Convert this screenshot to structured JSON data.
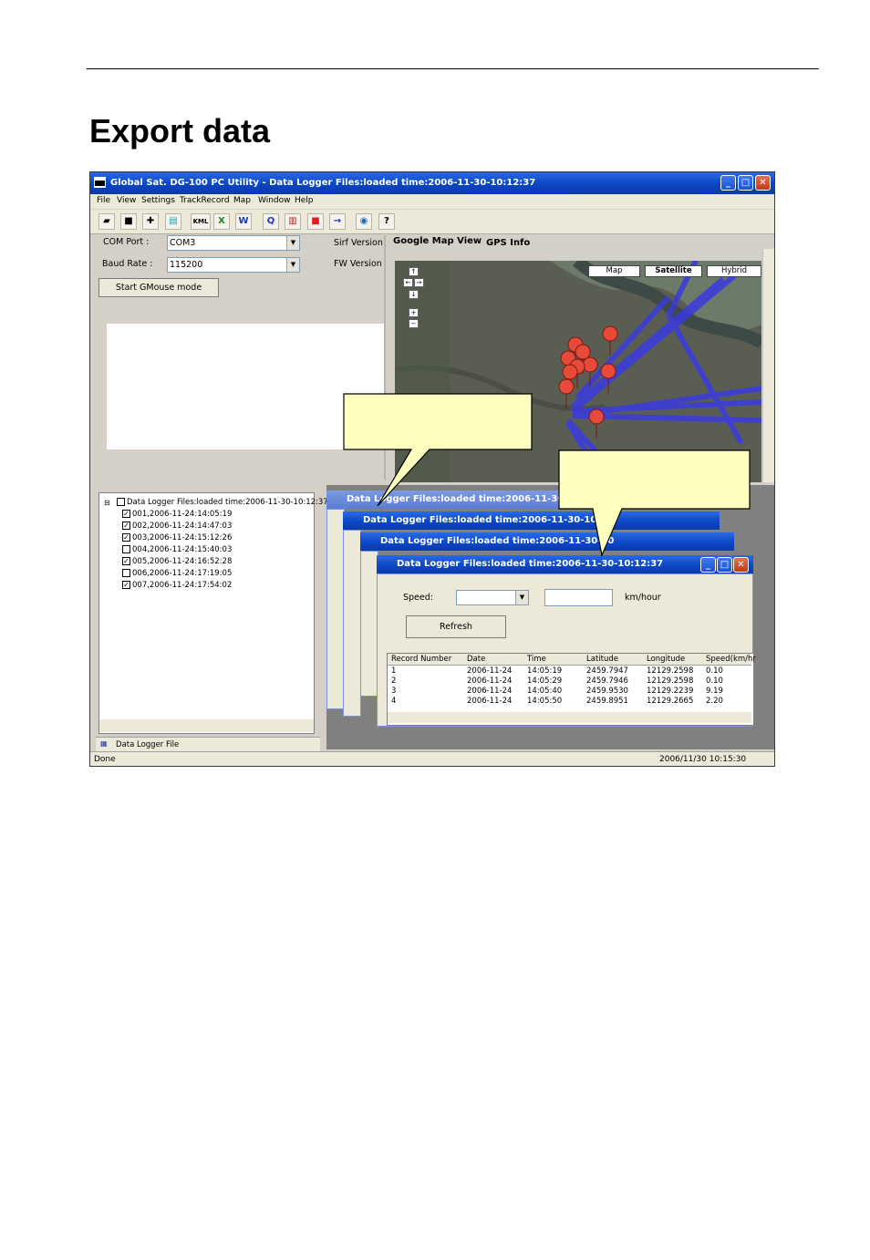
{
  "page": {
    "heading": "Export data"
  },
  "app": {
    "title": "Global Sat. DG-100 PC Utility - Data Logger Files:loaded time:2006-11-30-10:12:37",
    "window_buttons": [
      "_",
      "□",
      "✕"
    ]
  },
  "menu": [
    "File",
    "View",
    "Settings",
    "TrackRecord",
    "Map",
    "Window",
    "Help"
  ],
  "toolbar_icons": [
    "open-folder-icon",
    "save-icon",
    "pin-icon",
    "layers-icon",
    "kml-icon",
    "excel-icon",
    "word-icon",
    "zoom-icon",
    "record-icon",
    "stop-icon",
    "arrow-icon",
    "globe-icon",
    "help-icon"
  ],
  "toolbar_glyphs": [
    "▰",
    "■",
    "✚",
    "▤",
    "KML",
    "X",
    "W",
    "Q",
    "▥",
    "■",
    "→",
    "◉",
    "?"
  ],
  "settings": {
    "com_port_label": "COM Port :",
    "com_port_value": "COM3",
    "baud_rate_label": "Baud Rate :",
    "baud_rate_value": "115200",
    "gmouse_button": "Start GMouse mode",
    "sirf_version_label": "Sirf Version",
    "fw_version_label": "FW Version"
  },
  "map_tabs": [
    "Google Map View",
    "GPS Info"
  ],
  "map_types": [
    "Map",
    "Satellite",
    "Hybrid"
  ],
  "map_nav": [
    "↑",
    "←",
    "→",
    "↓",
    "+",
    "−"
  ],
  "tree": {
    "root": "Data Logger Files:loaded time:2006-11-30-10:12:37",
    "items": [
      {
        "label": "001,2006-11-24:14:05:19",
        "checked": true
      },
      {
        "label": "002,2006-11-24:14:47:03",
        "checked": true
      },
      {
        "label": "003,2006-11-24:15:12:26",
        "checked": true
      },
      {
        "label": "004,2006-11-24:15:40:03",
        "checked": false
      },
      {
        "label": "005,2006-11-24:16:52:28",
        "checked": true
      },
      {
        "label": "006,2006-11-24:17:19:05",
        "checked": false
      },
      {
        "label": "007,2006-11-24:17:54:02",
        "checked": true
      }
    ],
    "tab_label": "Data Logger File"
  },
  "children": {
    "title_full": "Data Logger Files:loaded time:2006-11-30-10:12:37",
    "title_cut1": "Data Logger Files:loaded time:2006-11-30-10",
    "title_cut2": "Data Logger Files:loaded time:2006-11-30-10:12",
    "title_cut3": "Data Logger Files:loaded time:2006-11-30-10"
  },
  "filter": {
    "speed_label": "Speed:",
    "unit": "km/hour",
    "refresh_button": "Refresh"
  },
  "table": {
    "columns": [
      "Record Number",
      "Date",
      "Time",
      "Latitude",
      "Longitude",
      "Speed(km/hr"
    ],
    "rows": [
      [
        "1",
        "2006-11-24",
        "14:05:19",
        "2459.7947",
        "12129.2598",
        "0.10"
      ],
      [
        "2",
        "2006-11-24",
        "14:05:29",
        "2459.7946",
        "12129.2598",
        "0.10"
      ],
      [
        "3",
        "2006-11-24",
        "14:05:40",
        "2459.9530",
        "12129.2239",
        "9.19"
      ],
      [
        "4",
        "2006-11-24",
        "14:05:50",
        "2459.8951",
        "12129.2665",
        "2.20"
      ]
    ]
  },
  "status": {
    "left": "Done",
    "datetime": "2006/11/30 10:15:30"
  },
  "colors": {
    "title_blue": "#0a46c4",
    "callout_fill": "#ffffc0",
    "route_blue": "#3a3ae0",
    "pin_red": "#e84a3a"
  }
}
